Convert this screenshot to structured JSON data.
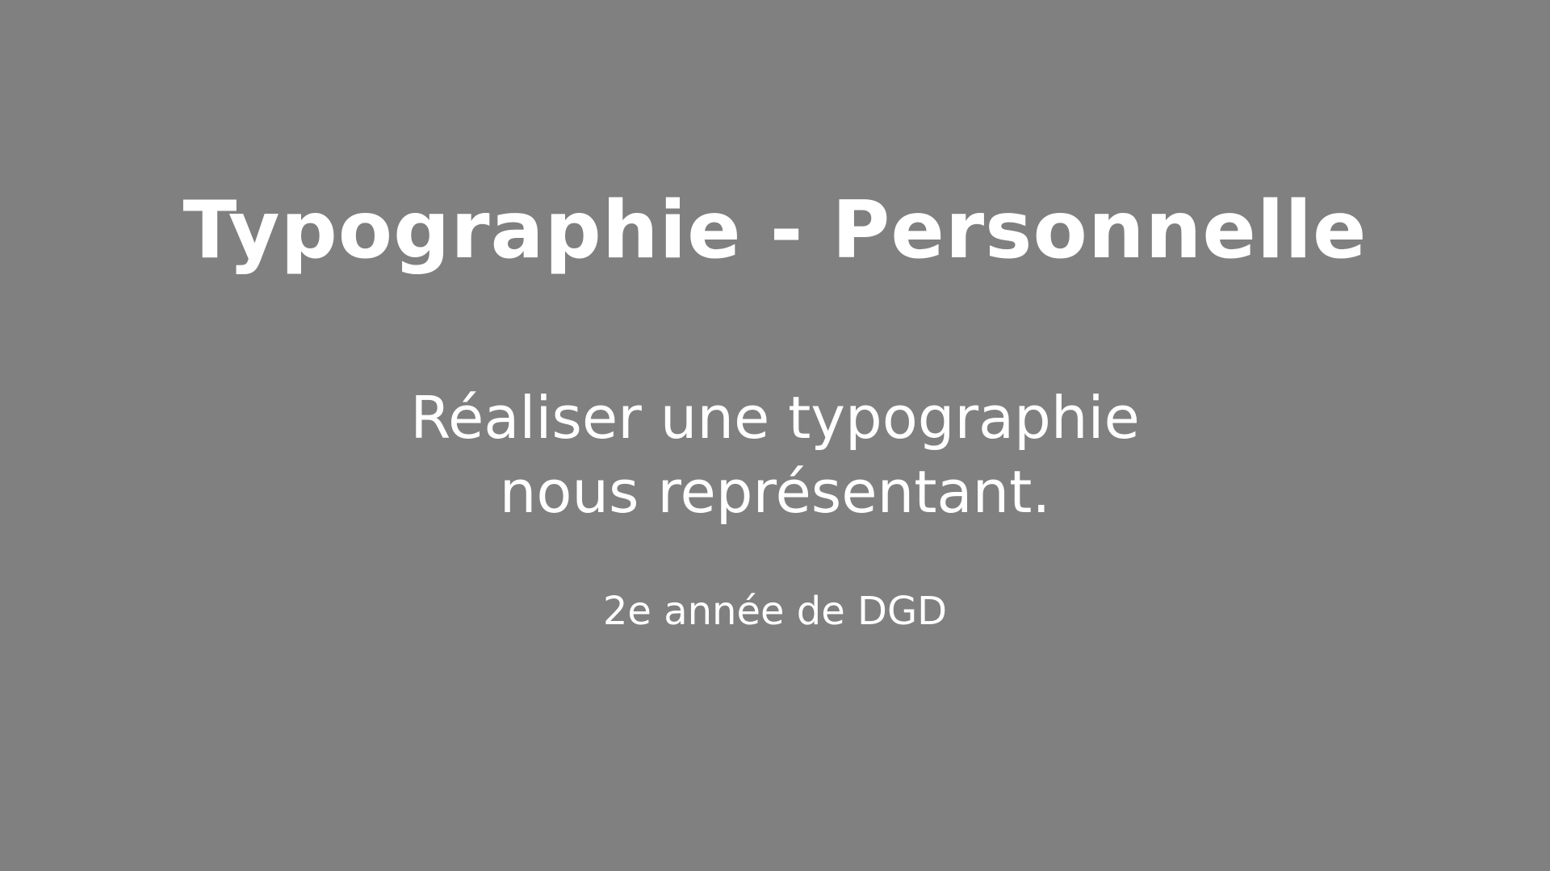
{
  "slide": {
    "title": "Typographie - Personnelle",
    "subtitle_lines": [
      "Réaliser une typographie",
      "nous représentant."
    ],
    "note": "2e année de DGD"
  },
  "colors": {
    "background": "#808080",
    "text": "#ffffff"
  }
}
